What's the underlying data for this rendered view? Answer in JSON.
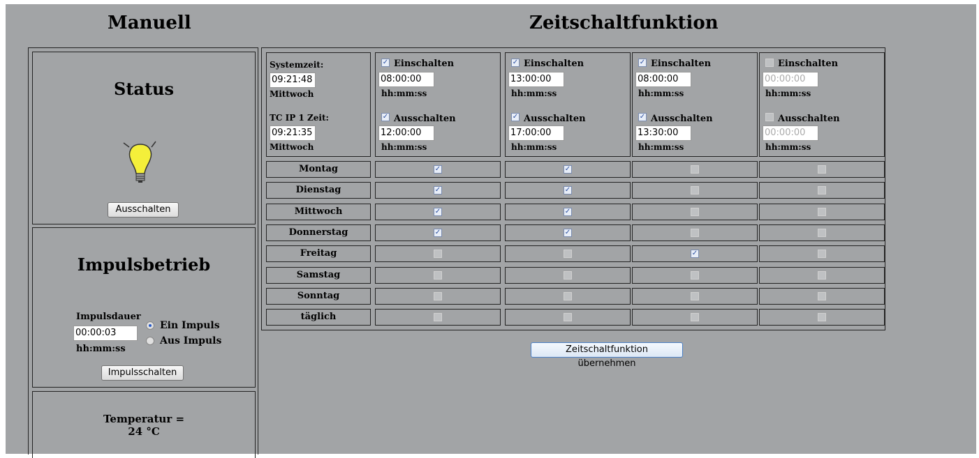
{
  "headings": {
    "manual": "Manuell",
    "timer": "Zeitschaltfunktion"
  },
  "status": {
    "title": "Status",
    "button": "Ausschalten"
  },
  "impulse": {
    "title": "Impulsbetrieb",
    "duration_label": "Impulsdauer",
    "duration_value": "00:00:03",
    "format": "hh:mm:ss",
    "option_on": "Ein Impuls",
    "option_off": "Aus Impuls",
    "button": "Impulsschalten"
  },
  "temperature": {
    "label": "Temperatur =",
    "value": "24 °C"
  },
  "system": {
    "time_label": "Systemzeit:",
    "time_value": "09:21:48",
    "day": "Mittwoch",
    "tc_label": "TC IP 1 Zeit:",
    "tc_value": "09:21:35",
    "tc_day": "Mittwoch"
  },
  "schedule_labels": {
    "on": "Einschalten",
    "off": "Ausschalten",
    "format": "hh:mm:ss"
  },
  "schedules": [
    {
      "on_checked": true,
      "on_time": "08:00:00",
      "off_checked": true,
      "off_time": "12:00:00",
      "enabled": true
    },
    {
      "on_checked": true,
      "on_time": "13:00:00",
      "off_checked": true,
      "off_time": "17:00:00",
      "enabled": true
    },
    {
      "on_checked": true,
      "on_time": "08:00:00",
      "off_checked": true,
      "off_time": "13:30:00",
      "enabled": true
    },
    {
      "on_checked": false,
      "on_time": "00:00:00",
      "off_checked": false,
      "off_time": "00:00:00",
      "enabled": false
    }
  ],
  "days": [
    "Montag",
    "Dienstag",
    "Mittwoch",
    "Donnerstag",
    "Freitag",
    "Samstag",
    "Sonntag",
    "täglich"
  ],
  "day_matrix": [
    [
      true,
      true,
      false,
      false
    ],
    [
      true,
      true,
      false,
      false
    ],
    [
      true,
      true,
      false,
      false
    ],
    [
      true,
      true,
      false,
      false
    ],
    [
      false,
      false,
      true,
      false
    ],
    [
      false,
      false,
      false,
      false
    ],
    [
      false,
      false,
      false,
      false
    ],
    [
      false,
      false,
      false,
      false
    ]
  ],
  "apply_button": "Zeitschaltfunktion übernehmen"
}
